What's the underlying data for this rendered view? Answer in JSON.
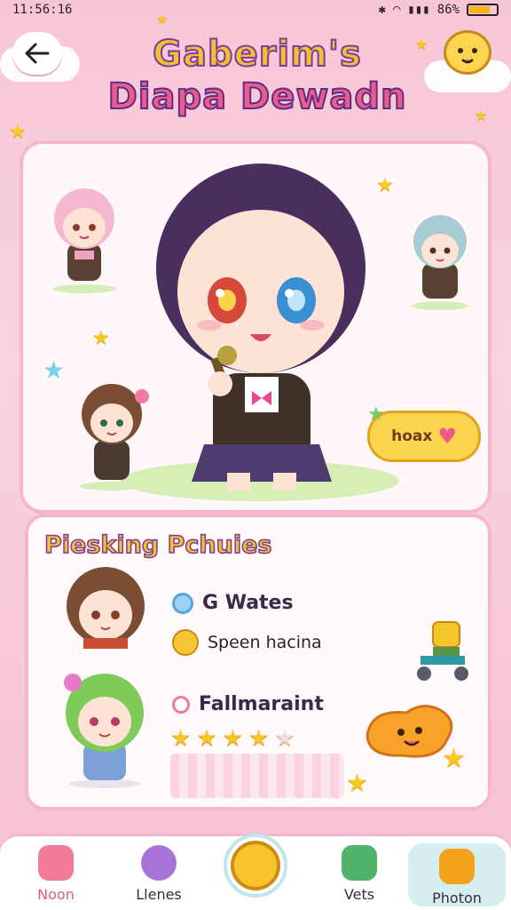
{
  "status": {
    "time": "11:56:16",
    "battery": "86%",
    "battery_fill": 0.78
  },
  "header": {
    "title_line1": "Gaberim's",
    "title_line2": "Diapa Dewadn"
  },
  "hero": {
    "speech_bubble": "hoax"
  },
  "info": {
    "section_title": "Piesking Pchuies",
    "items": [
      {
        "label": "G Wates"
      },
      {
        "label": "Speen hacina"
      },
      {
        "label": "Fallmaraint"
      }
    ],
    "rating": 4
  },
  "nav": {
    "items": [
      {
        "label": "Noon",
        "color": "#f47a9a"
      },
      {
        "label": "Llenes",
        "color": "#a873d6"
      },
      {
        "label": "Vets",
        "color": "#4fb36a"
      },
      {
        "label": "Photon",
        "color": "#f2a21b"
      }
    ]
  },
  "colors": {
    "accent": "#f6b7cb",
    "title_yellow": "#f5c02f",
    "title_pink": "#ef5b88"
  }
}
